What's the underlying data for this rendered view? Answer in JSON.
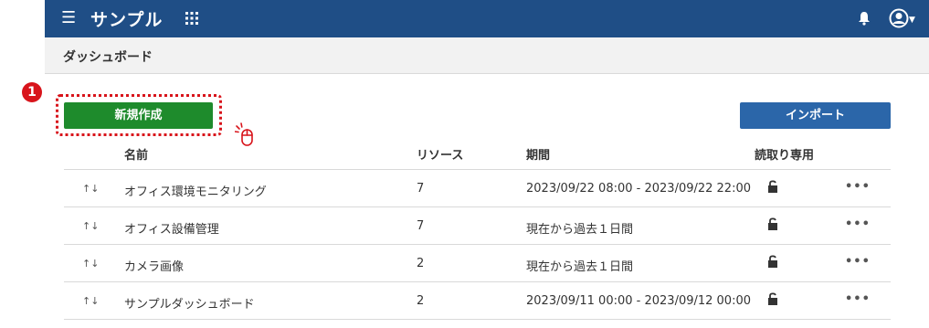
{
  "header": {
    "title": "サンプル",
    "menu_icon": "hamburger-icon",
    "apps_icon": "grid-icon",
    "bell_icon": "bell-icon",
    "user_icon": "user-circle-icon"
  },
  "subheader": {
    "breadcrumb": "ダッシュボード"
  },
  "actions": {
    "new_label": "新規作成",
    "import_label": "インポート",
    "step_badge": "1"
  },
  "table": {
    "columns": {
      "name": "名前",
      "resource": "リソース",
      "period": "期間",
      "readonly": "読取り専用"
    },
    "rows": [
      {
        "name": "オフィス環境モニタリング",
        "resource": "7",
        "period": "2023/09/22 08:00 - 2023/09/22 22:00"
      },
      {
        "name": "オフィス設備管理",
        "resource": "7",
        "period": "現在から過去１日間"
      },
      {
        "name": "カメラ画像",
        "resource": "2",
        "period": "現在から過去１日間"
      },
      {
        "name": "サンプルダッシュボード",
        "resource": "2",
        "period": "2023/09/11 00:00 - 2023/09/12 00:00"
      }
    ]
  },
  "colors": {
    "header_bg": "#1f4e86",
    "new_button": "#1e8b2c",
    "import_button": "#2b66a9",
    "highlight": "#d8141b"
  }
}
